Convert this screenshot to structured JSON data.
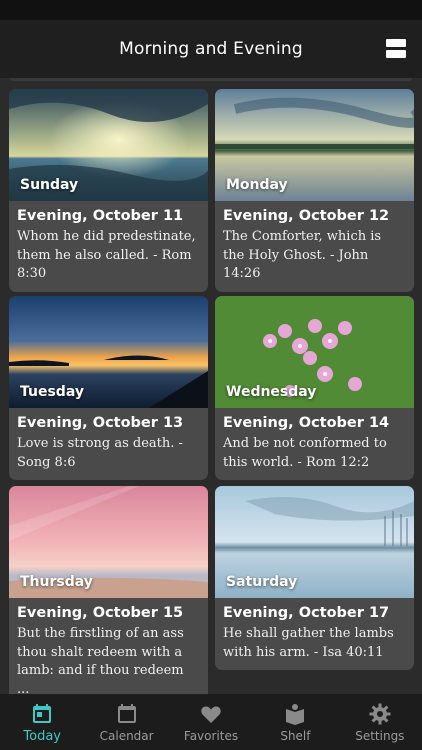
{
  "header": {
    "title": "Morning and Evening",
    "menu_icon": "menu-icon"
  },
  "cards": [
    {
      "day": "Sunday",
      "title": "Evening, October 11",
      "text": "Whom he did predestinate, them he also called. - Rom 8:30"
    },
    {
      "day": "Monday",
      "title": "Evening, October 12",
      "text": "The Comforter, which is the Holy Ghost. - John 14:26"
    },
    {
      "day": "Tuesday",
      "title": "Evening, October 13",
      "text": "Love is strong as death. - Song 8:6"
    },
    {
      "day": "Wednesday",
      "title": "Evening, October 14",
      "text": "And be not conformed to this world. - Rom 12:2"
    },
    {
      "day": "Thursday",
      "title": "Evening, October 15",
      "text": "But the firstling of an ass thou shalt redeem with a lamb: and if thou redeem ..."
    },
    {
      "day": "Saturday",
      "title": "Evening, October 17",
      "text": "He shall gather the lambs with his arm. - Isa 40:11"
    }
  ],
  "tabs": [
    {
      "label": "Today",
      "icon": "calendar-today-icon",
      "active": true
    },
    {
      "label": "Calendar",
      "icon": "calendar-icon",
      "active": false
    },
    {
      "label": "Favorites",
      "icon": "heart-icon",
      "active": false
    },
    {
      "label": "Shelf",
      "icon": "book-icon",
      "active": false
    },
    {
      "label": "Settings",
      "icon": "gear-icon",
      "active": false
    }
  ],
  "colors": {
    "accent": "#3fc9c4",
    "card_bg": "#4a4a4a",
    "page_bg": "#2b2b2b"
  }
}
